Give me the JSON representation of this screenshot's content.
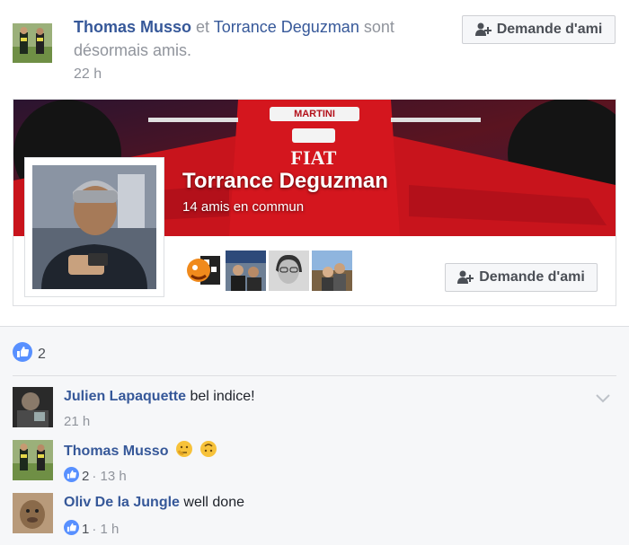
{
  "post": {
    "actor1": "Thomas Musso",
    "connector": "et",
    "actor2": "Torrance Deguzman",
    "action": "sont désormais amis.",
    "time": "22 h",
    "friend_button": "Demande d'ami"
  },
  "card": {
    "name": "Torrance Deguzman",
    "mutual": "14 amis en commun",
    "friend_button": "Demande d'ami",
    "cover_text": [
      "MARTINI",
      "FIAT"
    ]
  },
  "reactions": {
    "like_count": "2"
  },
  "comments": [
    {
      "name": "Julien Lapaquette",
      "text": "bel indice!",
      "meta": "21 h"
    },
    {
      "name": "Thomas Musso",
      "text": "",
      "likes": "2",
      "meta": "· 13 h"
    },
    {
      "name": "Oliv De la Jungle",
      "text": "well done",
      "likes": "1",
      "meta": "· 1 h"
    }
  ],
  "colors": {
    "link": "#365899",
    "muted": "#90949c",
    "like_blue": "#5890ff",
    "cover_red": "#c8141c"
  }
}
